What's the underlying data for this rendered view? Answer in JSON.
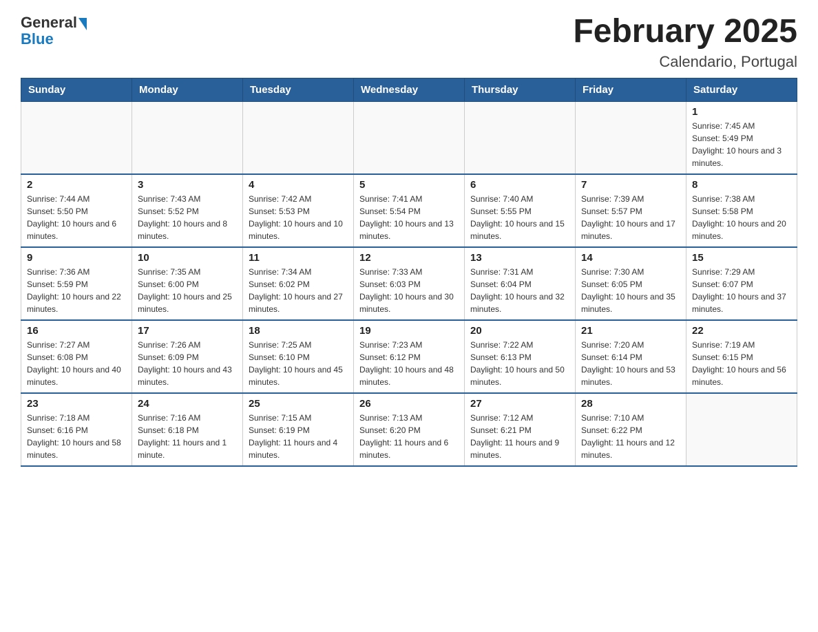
{
  "logo": {
    "general": "General",
    "blue": "Blue"
  },
  "title": "February 2025",
  "subtitle": "Calendario, Portugal",
  "headers": [
    "Sunday",
    "Monday",
    "Tuesday",
    "Wednesday",
    "Thursday",
    "Friday",
    "Saturday"
  ],
  "weeks": [
    [
      {
        "day": "",
        "info": ""
      },
      {
        "day": "",
        "info": ""
      },
      {
        "day": "",
        "info": ""
      },
      {
        "day": "",
        "info": ""
      },
      {
        "day": "",
        "info": ""
      },
      {
        "day": "",
        "info": ""
      },
      {
        "day": "1",
        "info": "Sunrise: 7:45 AM\nSunset: 5:49 PM\nDaylight: 10 hours and 3 minutes."
      }
    ],
    [
      {
        "day": "2",
        "info": "Sunrise: 7:44 AM\nSunset: 5:50 PM\nDaylight: 10 hours and 6 minutes."
      },
      {
        "day": "3",
        "info": "Sunrise: 7:43 AM\nSunset: 5:52 PM\nDaylight: 10 hours and 8 minutes."
      },
      {
        "day": "4",
        "info": "Sunrise: 7:42 AM\nSunset: 5:53 PM\nDaylight: 10 hours and 10 minutes."
      },
      {
        "day": "5",
        "info": "Sunrise: 7:41 AM\nSunset: 5:54 PM\nDaylight: 10 hours and 13 minutes."
      },
      {
        "day": "6",
        "info": "Sunrise: 7:40 AM\nSunset: 5:55 PM\nDaylight: 10 hours and 15 minutes."
      },
      {
        "day": "7",
        "info": "Sunrise: 7:39 AM\nSunset: 5:57 PM\nDaylight: 10 hours and 17 minutes."
      },
      {
        "day": "8",
        "info": "Sunrise: 7:38 AM\nSunset: 5:58 PM\nDaylight: 10 hours and 20 minutes."
      }
    ],
    [
      {
        "day": "9",
        "info": "Sunrise: 7:36 AM\nSunset: 5:59 PM\nDaylight: 10 hours and 22 minutes."
      },
      {
        "day": "10",
        "info": "Sunrise: 7:35 AM\nSunset: 6:00 PM\nDaylight: 10 hours and 25 minutes."
      },
      {
        "day": "11",
        "info": "Sunrise: 7:34 AM\nSunset: 6:02 PM\nDaylight: 10 hours and 27 minutes."
      },
      {
        "day": "12",
        "info": "Sunrise: 7:33 AM\nSunset: 6:03 PM\nDaylight: 10 hours and 30 minutes."
      },
      {
        "day": "13",
        "info": "Sunrise: 7:31 AM\nSunset: 6:04 PM\nDaylight: 10 hours and 32 minutes."
      },
      {
        "day": "14",
        "info": "Sunrise: 7:30 AM\nSunset: 6:05 PM\nDaylight: 10 hours and 35 minutes."
      },
      {
        "day": "15",
        "info": "Sunrise: 7:29 AM\nSunset: 6:07 PM\nDaylight: 10 hours and 37 minutes."
      }
    ],
    [
      {
        "day": "16",
        "info": "Sunrise: 7:27 AM\nSunset: 6:08 PM\nDaylight: 10 hours and 40 minutes."
      },
      {
        "day": "17",
        "info": "Sunrise: 7:26 AM\nSunset: 6:09 PM\nDaylight: 10 hours and 43 minutes."
      },
      {
        "day": "18",
        "info": "Sunrise: 7:25 AM\nSunset: 6:10 PM\nDaylight: 10 hours and 45 minutes."
      },
      {
        "day": "19",
        "info": "Sunrise: 7:23 AM\nSunset: 6:12 PM\nDaylight: 10 hours and 48 minutes."
      },
      {
        "day": "20",
        "info": "Sunrise: 7:22 AM\nSunset: 6:13 PM\nDaylight: 10 hours and 50 minutes."
      },
      {
        "day": "21",
        "info": "Sunrise: 7:20 AM\nSunset: 6:14 PM\nDaylight: 10 hours and 53 minutes."
      },
      {
        "day": "22",
        "info": "Sunrise: 7:19 AM\nSunset: 6:15 PM\nDaylight: 10 hours and 56 minutes."
      }
    ],
    [
      {
        "day": "23",
        "info": "Sunrise: 7:18 AM\nSunset: 6:16 PM\nDaylight: 10 hours and 58 minutes."
      },
      {
        "day": "24",
        "info": "Sunrise: 7:16 AM\nSunset: 6:18 PM\nDaylight: 11 hours and 1 minute."
      },
      {
        "day": "25",
        "info": "Sunrise: 7:15 AM\nSunset: 6:19 PM\nDaylight: 11 hours and 4 minutes."
      },
      {
        "day": "26",
        "info": "Sunrise: 7:13 AM\nSunset: 6:20 PM\nDaylight: 11 hours and 6 minutes."
      },
      {
        "day": "27",
        "info": "Sunrise: 7:12 AM\nSunset: 6:21 PM\nDaylight: 11 hours and 9 minutes."
      },
      {
        "day": "28",
        "info": "Sunrise: 7:10 AM\nSunset: 6:22 PM\nDaylight: 11 hours and 12 minutes."
      },
      {
        "day": "",
        "info": ""
      }
    ]
  ]
}
